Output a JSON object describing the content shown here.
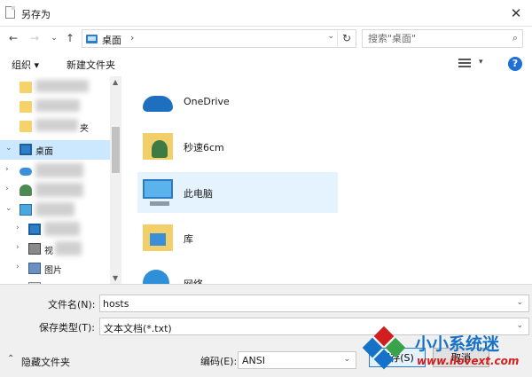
{
  "window": {
    "title": "另存为",
    "close_glyph": "✕"
  },
  "nav": {
    "back_glyph": "←",
    "forward_glyph": "→",
    "recent_glyph": "⌄",
    "up_glyph": "↑",
    "address_crumb": "桌面",
    "address_sep": "›",
    "address_dropdown_glyph": "⌄",
    "refresh_glyph": "↻",
    "search_placeholder": "搜索\"桌面\"",
    "search_glyph": "⌕"
  },
  "toolbar": {
    "organize_label": "组织 ▾",
    "new_folder_label": "新建文件夹",
    "view_dropdown_glyph": "▾",
    "help_glyph": "?"
  },
  "tree": {
    "chevron_collapsed": "›",
    "chevron_expanded": "⌄",
    "items": [
      {
        "label": "",
        "icon": "folder-icon"
      },
      {
        "label": "",
        "icon": "folder-icon"
      },
      {
        "label": "夹",
        "icon": "folder-icon"
      },
      {
        "label": "桌面",
        "icon": "desktop-icon"
      },
      {
        "label": "",
        "icon": "onedrive-icon"
      },
      {
        "label": "",
        "icon": "user-icon"
      },
      {
        "label": "",
        "icon": "computer-icon"
      },
      {
        "label": "",
        "icon": "desktop-icon"
      },
      {
        "label": "视",
        "icon": "video-icon"
      },
      {
        "label": "图片",
        "icon": "pictures-icon"
      },
      {
        "label": "",
        "icon": "documents-icon"
      }
    ],
    "scroll_up_glyph": "▲",
    "scroll_down_glyph": "▼"
  },
  "files": [
    {
      "name": "OneDrive",
      "icon": "onedrive-icon"
    },
    {
      "name": "秒速6cm",
      "icon": "user-folder-icon"
    },
    {
      "name": "此电脑",
      "icon": "computer-icon"
    },
    {
      "name": "库",
      "icon": "library-icon"
    },
    {
      "name": "网络",
      "icon": "network-icon"
    }
  ],
  "form": {
    "filename_label": "文件名(N):",
    "filename_value": "hosts",
    "savetype_label": "保存类型(T):",
    "savetype_value": "文本文档(*.txt)",
    "encoding_label": "编码(E):",
    "encoding_value": "ANSI",
    "dropdown_glyph": "⌄",
    "hide_folders_label": "隐藏文件夹",
    "hide_folders_glyph": "⌃",
    "save_button_label": "保存(S)",
    "cancel_button_label": "取消"
  },
  "watermark": {
    "name": "小小系统迷",
    "url": "www.ilovext.com"
  },
  "colors": {
    "selection": "#cce8ff",
    "hover": "#e5f3ff",
    "accent": "#1e6fd6",
    "watermark_blue": "#1672c8",
    "watermark_red": "#d11f1f",
    "watermark_green": "#3aa34a"
  }
}
